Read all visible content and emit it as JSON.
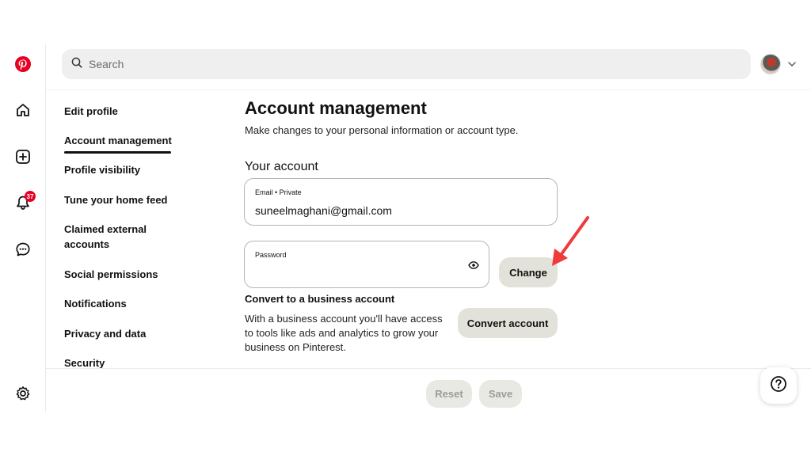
{
  "app": {
    "logo": "pinterest-logo",
    "brand_color": "#e60023"
  },
  "rail": {
    "icons": [
      "home-icon",
      "create-icon",
      "notifications-icon",
      "messages-icon",
      "settings-icon"
    ],
    "notification_count": "37"
  },
  "search": {
    "placeholder": "Search",
    "icon": "search-icon"
  },
  "header": {
    "avatar": "avatar",
    "caret": "chevron-down-icon"
  },
  "settings_nav": {
    "items": [
      {
        "label": "Edit profile"
      },
      {
        "label": "Account management"
      },
      {
        "label": "Profile visibility"
      },
      {
        "label": "Tune your home feed"
      },
      {
        "label": "Claimed external accounts"
      },
      {
        "label": "Social permissions"
      },
      {
        "label": "Notifications"
      },
      {
        "label": "Privacy and data"
      },
      {
        "label": "Security"
      }
    ],
    "active": "Account management"
  },
  "main": {
    "title": "Account management",
    "subtitle": "Make changes to your personal information or account type.",
    "section_title": "Your account",
    "email": {
      "label": "Email • Private",
      "value": "suneelmaghani@gmail.com"
    },
    "password": {
      "label": "Password",
      "value": "",
      "toggle_icon": "eye-icon"
    },
    "change_label": "Change",
    "convert": {
      "title": "Convert to a business account",
      "text": "With a business account you'll have access to tools like ads and analytics to grow your business on Pinterest.",
      "button_label": "Convert account"
    }
  },
  "footer": {
    "reset_label": "Reset",
    "save_label": "Save"
  },
  "help": {
    "icon": "help-icon"
  },
  "annotation": {
    "color": "#ef3b3b"
  }
}
